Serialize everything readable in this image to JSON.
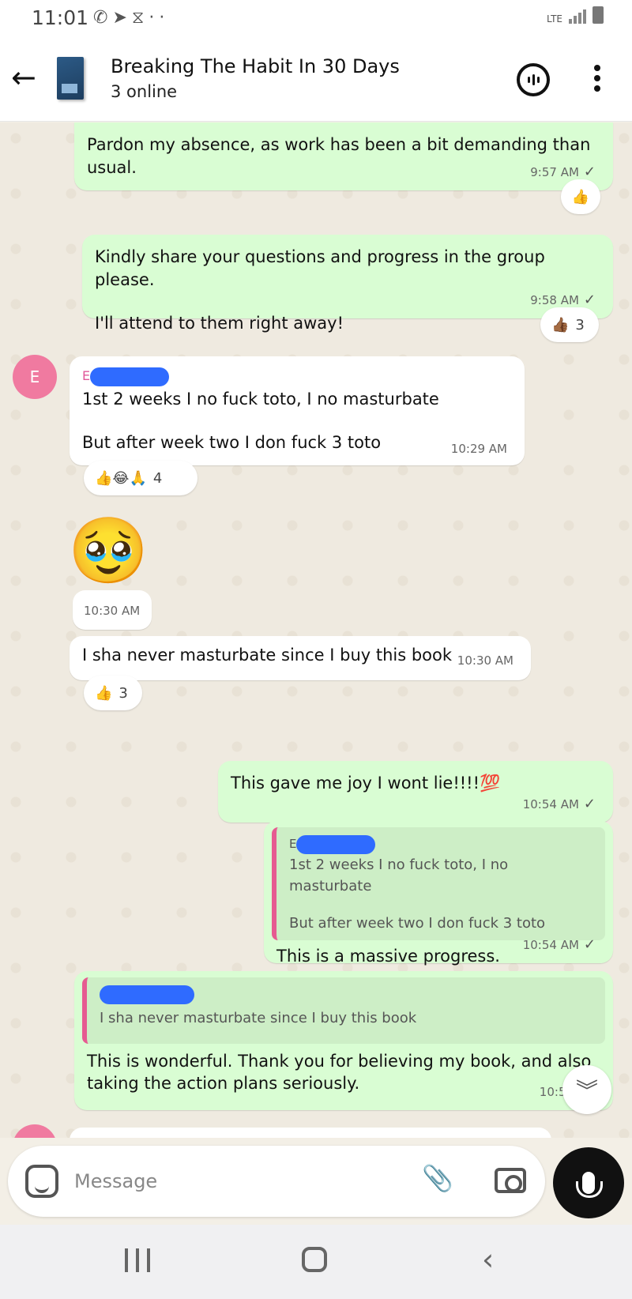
{
  "status_bar": {
    "time": "11:01",
    "icons": [
      "whatsapp-icon",
      "telegram-icon",
      "fiverr-icon"
    ],
    "more": "··",
    "network": "LTE"
  },
  "header": {
    "title": "Breaking The Habit In 30 Days",
    "subtitle": "3 online",
    "group_image": "book-cover"
  },
  "messages": [
    {
      "type": "out",
      "text": "Pardon my absence, as work has been a bit demanding than usual.",
      "time": "9:57 AM",
      "reaction": "👍"
    },
    {
      "type": "out",
      "line1": "Kindly share your questions and progress in the group please.",
      "line2": "I'll attend to them right away!",
      "time": "9:58 AM",
      "reaction": "👍🏾",
      "reaction_count": "3"
    },
    {
      "type": "in",
      "avatar": "E",
      "sender": "E",
      "line1": "1st 2 weeks I no fuck toto, I no masturbate",
      "line2": "But after week two I don fuck 3 toto",
      "time": "10:29 AM",
      "reaction": "👍😂🙏",
      "reaction_count": "4"
    },
    {
      "type": "in",
      "emoji": "🥹",
      "time": "10:30 AM"
    },
    {
      "type": "in",
      "text": "I sha never masturbate since I buy this book",
      "time": "10:30 AM",
      "reaction": "👍",
      "reaction_count": "3"
    },
    {
      "type": "out",
      "text": "This gave me joy I wont lie!!!!💯",
      "time": "10:54 AM"
    },
    {
      "type": "out",
      "quote_sender": "E",
      "quote_line1": "1st 2 weeks I no fuck toto, I no masturbate",
      "quote_line2": "But after week two I don fuck 3 toto",
      "text": "This is a massive progress.",
      "time": "10:54 AM"
    },
    {
      "type": "out",
      "quote_line1": "I sha never masturbate since I buy this book",
      "text": "This is wonderful. Thank you for believing my book, and also taking the action plans seriously.",
      "time": "10:55 AM"
    }
  ],
  "composer": {
    "placeholder": "Message"
  }
}
